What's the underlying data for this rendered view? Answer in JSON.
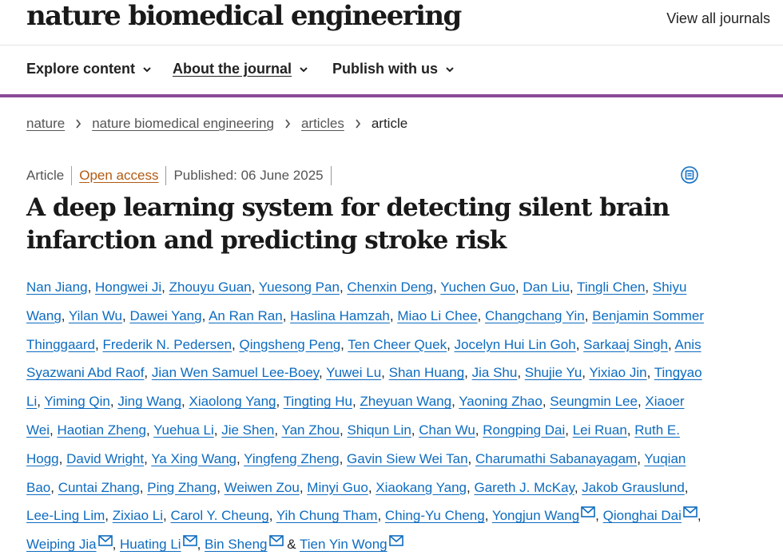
{
  "header": {
    "journal_title": "nature biomedical engineering",
    "view_all": "View all journals"
  },
  "nav": {
    "explore": "Explore content",
    "about": "About the journal",
    "publish": "Publish with us"
  },
  "breadcrumb": {
    "nature": "nature",
    "journal": "nature biomedical engineering",
    "articles": "articles",
    "current": "article"
  },
  "meta": {
    "type": "Article",
    "access": "Open access",
    "published": "Published: 06 June 2025"
  },
  "article": {
    "title": "A deep learning system for detecting silent brain infarction and predicting stroke risk"
  },
  "authors": [
    {
      "name": "Nan Jiang"
    },
    {
      "name": "Hongwei Ji"
    },
    {
      "name": "Zhouyu Guan"
    },
    {
      "name": "Yuesong Pan"
    },
    {
      "name": "Chenxin Deng"
    },
    {
      "name": "Yuchen Guo"
    },
    {
      "name": "Dan Liu"
    },
    {
      "name": "Tingli Chen"
    },
    {
      "name": "Shiyu Wang"
    },
    {
      "name": "Yilan Wu"
    },
    {
      "name": "Dawei Yang"
    },
    {
      "name": "An Ran Ran"
    },
    {
      "name": "Haslina Hamzah"
    },
    {
      "name": "Miao Li Chee"
    },
    {
      "name": "Changchang Yin"
    },
    {
      "name": "Benjamin Sommer Thinggaard"
    },
    {
      "name": "Frederik N. Pedersen"
    },
    {
      "name": "Qingsheng Peng"
    },
    {
      "name": "Ten Cheer Quek"
    },
    {
      "name": "Jocelyn Hui Lin Goh"
    },
    {
      "name": "Sarkaaj Singh"
    },
    {
      "name": "Anis Syazwani Abd Raof"
    },
    {
      "name": "Jian Wen Samuel Lee-Boey"
    },
    {
      "name": "Yuwei Lu"
    },
    {
      "name": "Shan Huang"
    },
    {
      "name": "Jia Shu"
    },
    {
      "name": "Shujie Yu"
    },
    {
      "name": "Yixiao Jin"
    },
    {
      "name": "Tingyao Li"
    },
    {
      "name": "Yiming Qin"
    },
    {
      "name": "Jing Wang"
    },
    {
      "name": "Xiaolong Yang"
    },
    {
      "name": "Tingting Hu"
    },
    {
      "name": "Zheyuan Wang"
    },
    {
      "name": "Yaoning Zhao"
    },
    {
      "name": "Seungmin Lee"
    },
    {
      "name": "Xiaoer Wei"
    },
    {
      "name": "Haotian Zheng"
    },
    {
      "name": "Yuehua Li"
    },
    {
      "name": "Jie Shen"
    },
    {
      "name": "Yan Zhou"
    },
    {
      "name": "Shiqun Lin"
    },
    {
      "name": "Chan Wu"
    },
    {
      "name": "Rongping Dai"
    },
    {
      "name": "Lei Ruan"
    },
    {
      "name": "Ruth E. Hogg"
    },
    {
      "name": "David Wright"
    },
    {
      "name": "Ya Xing Wang"
    },
    {
      "name": "Yingfeng Zheng"
    },
    {
      "name": "Gavin Siew Wei Tan"
    },
    {
      "name": "Charumathi Sabanayagam"
    },
    {
      "name": "Yuqian Bao"
    },
    {
      "name": "Cuntai Zhang"
    },
    {
      "name": "Ping Zhang"
    },
    {
      "name": "Weiwen Zou"
    },
    {
      "name": "Minyi Guo"
    },
    {
      "name": "Xiaokang Yang"
    },
    {
      "name": "Gareth J. McKay"
    },
    {
      "name": "Jakob Grauslund"
    },
    {
      "name": "Lee-Ling Lim"
    },
    {
      "name": "Zixiao Li"
    },
    {
      "name": "Carol Y. Cheung"
    },
    {
      "name": "Yih Chung Tham"
    },
    {
      "name": "Ching-Yu Cheng"
    },
    {
      "name": "Yongjun Wang",
      "email": true
    },
    {
      "name": "Qionghai Dai",
      "email": true
    },
    {
      "name": "Weiping Jia",
      "email": true
    },
    {
      "name": "Huating Li",
      "email": true
    },
    {
      "name": "Bin Sheng",
      "email": true
    },
    {
      "name": "Tien Yin Wong",
      "email": true
    }
  ],
  "authors_final_sep": "&",
  "colors": {
    "nav_bar_accent": "#8a4a96",
    "link_blue": "#0e6cc0",
    "open_access": "#b35a12"
  },
  "icons": {
    "dropdown": "chevron-down-icon",
    "breadcrumb_separator": "chevron-right-icon",
    "citation": "citation-download-icon",
    "author_email": "mail-icon"
  }
}
